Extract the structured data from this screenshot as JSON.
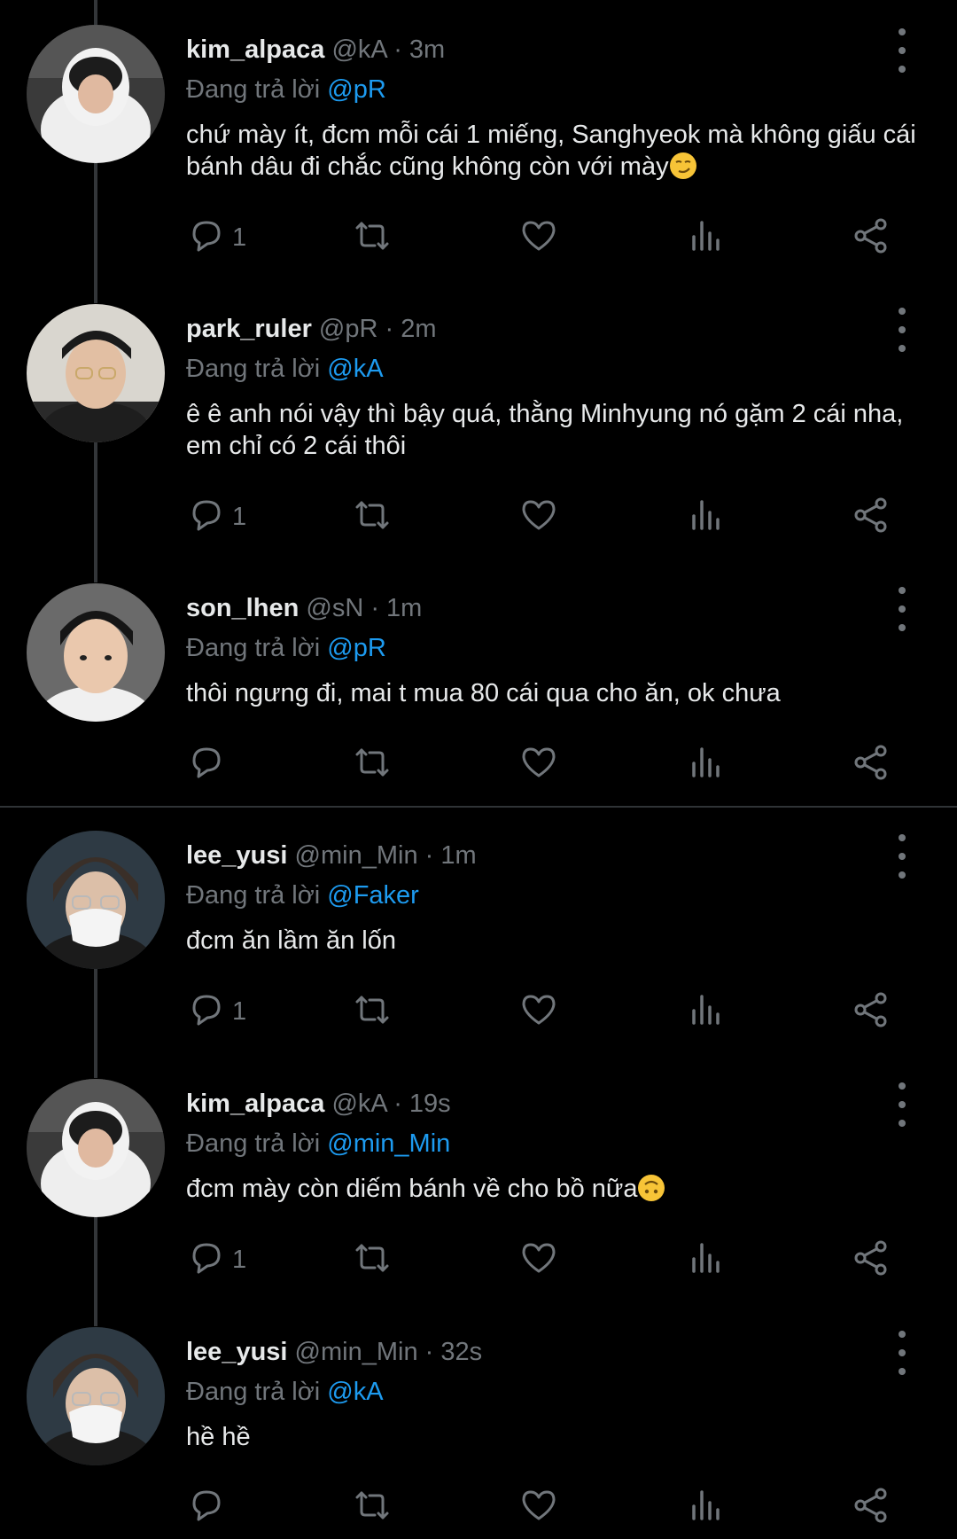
{
  "labels": {
    "replying_prefix": "Đang trả lời"
  },
  "tweets": [
    {
      "name": "kim_alpaca",
      "meta": "@kA · 3m",
      "reply_to": "@pR",
      "text": "chứ mày ít, đcm mỗi cái 1 miếng, Sanghyeok mà không giấu cái bánh dâu đi chắc cũng không còn với mày",
      "emoji": "smirk-emoji",
      "reply_count": "1"
    },
    {
      "name": "park_ruler",
      "meta": "@pR · 2m",
      "reply_to": "@kA",
      "text": "ê ê anh nói vậy thì bậy quá, thằng Minhyung nó gặm 2 cái nha, em chỉ có 2 cái thôi",
      "reply_count": "1"
    },
    {
      "name": "son_lhen",
      "meta": "@sN · 1m",
      "reply_to": "@pR",
      "text": "thôi ngưng đi, mai t mua 80 cái qua cho ăn, ok chưa",
      "reply_count": ""
    },
    {
      "name": "lee_yusi",
      "meta": "@min_Min · 1m",
      "reply_to": "@Faker",
      "text": "đcm ăn lầm ăn lốn",
      "reply_count": "1"
    },
    {
      "name": "kim_alpaca",
      "meta": "@kA · 19s",
      "reply_to": "@min_Min",
      "text": "đcm mày còn diếm bánh về cho bồ nữa",
      "emoji": "upside-down-face-emoji",
      "reply_count": "1"
    },
    {
      "name": "lee_yusi",
      "meta": "@min_Min · 32s",
      "reply_to": "@kA",
      "text": "hề hề",
      "reply_count": ""
    }
  ],
  "colors": {
    "background": "#000000",
    "text": "#e7e9ea",
    "muted": "#71767b",
    "accent": "#1d9bf0",
    "thread_line": "#333639"
  },
  "icons": [
    "reply-icon",
    "retweet-icon",
    "like-icon",
    "views-icon",
    "share-icon",
    "more-icon"
  ]
}
